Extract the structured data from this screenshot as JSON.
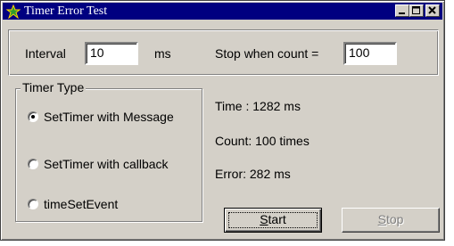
{
  "window": {
    "title": "Timer Error Test",
    "icon": "app-icon",
    "controls": [
      "minimize",
      "maximize",
      "close"
    ]
  },
  "settings": {
    "interval_label": "Interval",
    "interval_value": "10",
    "interval_unit": "ms",
    "stop_label": "Stop when count =",
    "stop_value": "100"
  },
  "timer_type": {
    "title": "Timer Type",
    "options": [
      {
        "label": "SetTimer with Message",
        "selected": true
      },
      {
        "label": "SetTimer with callback",
        "selected": false
      },
      {
        "label": "timeSetEvent",
        "selected": false
      }
    ]
  },
  "results": {
    "time": "Time : 1282 ms",
    "count": "Count: 100 times",
    "error": "Error: 282 ms"
  },
  "buttons": {
    "start_label": "Start",
    "start_mnemonic": "S",
    "start_rest": "tart",
    "stop_label": "Stop",
    "stop_mnemonic": "S",
    "stop_rest": "top",
    "stop_enabled": false
  },
  "colors": {
    "face": "#d4d0c8",
    "titlebar": "#000080",
    "disabled_text": "#808080"
  }
}
